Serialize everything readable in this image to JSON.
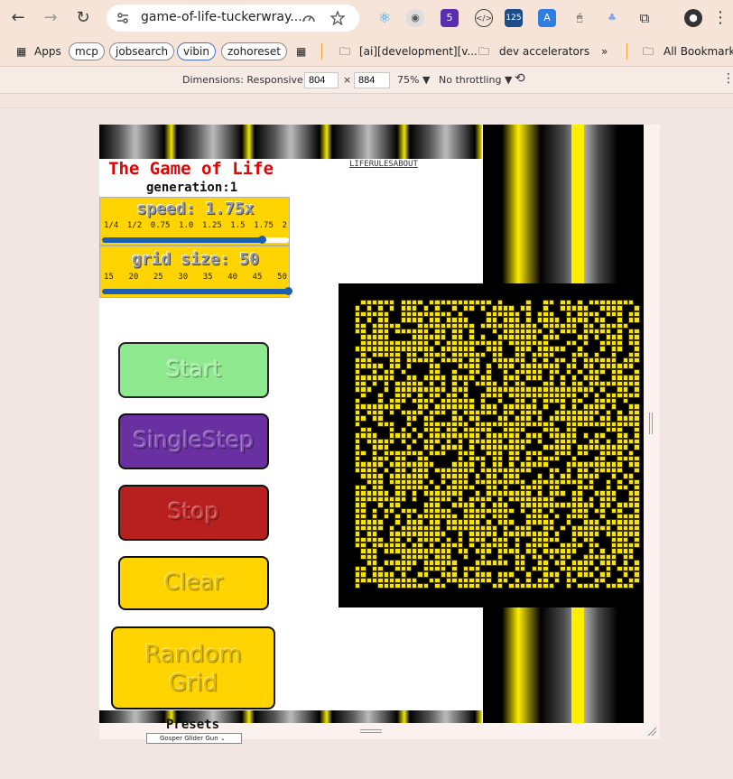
{
  "browser": {
    "url": "game-of-life-tuckerwray....",
    "extensions": [
      "react-icon",
      "ext-icon",
      "ext-5",
      "ext-code",
      "ext-125",
      "ext-translate",
      "ext-mouse",
      "ext-lungs",
      "puzzle-icon"
    ],
    "ext_badges": {
      "five": "5",
      "counter": "125"
    }
  },
  "bookmarks": {
    "apps": "Apps",
    "chips": [
      "mcp",
      "jobsearch",
      "vibin",
      "zohoreset"
    ],
    "folder1": "[ai][development][v...",
    "folder2": "dev accelerators",
    "more": "»",
    "all": "All Bookmarks"
  },
  "devtools": {
    "dimensions_label": "Dimensions: Responsive ▼",
    "width": "804",
    "times": "×",
    "height": "884",
    "zoom": "75% ▼",
    "throttling": "No throttling ▼"
  },
  "app": {
    "title": "The Game of Life",
    "generation": "generation:1",
    "nav_links": [
      "LIFE",
      "RULES",
      "ABOUT"
    ],
    "speed": {
      "title": "speed: 1.75x",
      "ticks": [
        "1/4",
        "1/2",
        "0.75",
        "1.0",
        "1.25",
        "1.5",
        "1.75",
        "2"
      ],
      "value_fraction": 0.86
    },
    "grid_size": {
      "title": "grid size: 50",
      "ticks": [
        "15",
        "20",
        "25",
        "30",
        "35",
        "40",
        "45",
        "50"
      ],
      "value_fraction": 1.0
    },
    "buttons": {
      "start": "Start",
      "single_step": "SingleStep",
      "stop": "Stop",
      "clear": "Clear",
      "random_line1": "Random",
      "random_line2": "Grid"
    },
    "presets_label": "Presets",
    "preset_selected": "Gosper Glider Gun",
    "grid": {
      "rows": 50,
      "cols": 50
    }
  },
  "colors": {
    "alive": "#f6e500",
    "dead": "#000000",
    "title_red": "#e60000",
    "control_yellow": "#ffd400",
    "slider_blue": "#1b5fb4"
  }
}
